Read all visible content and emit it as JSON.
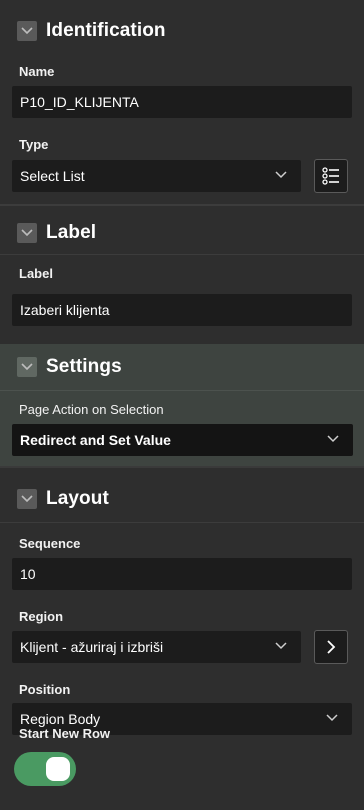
{
  "sections": {
    "identification": {
      "title": "Identification",
      "name_label": "Name",
      "name_value": "P10_ID_KLIJENTA",
      "type_label": "Type",
      "type_value": "Select List",
      "type_button_icon": "list-icon"
    },
    "label": {
      "title": "Label",
      "label_label": "Label",
      "label_value": "Izaberi klijenta"
    },
    "settings": {
      "title": "Settings",
      "page_action_label": "Page Action on Selection",
      "page_action_value": "Redirect and Set Value"
    },
    "layout": {
      "title": "Layout",
      "sequence_label": "Sequence",
      "sequence_value": "10",
      "region_label": "Region",
      "region_value": "Klijent - ažuriraj i izbriši",
      "region_button_icon": "chevron-right-icon",
      "position_label": "Position",
      "position_value": "Region Body",
      "start_new_row_label": "Start New Row",
      "start_new_row_on": true
    }
  },
  "colors": {
    "background": "#2e2e2e",
    "field_background": "#1c1c1c",
    "settings_background": "#3e4440",
    "toggle_on": "#4a9a62"
  }
}
